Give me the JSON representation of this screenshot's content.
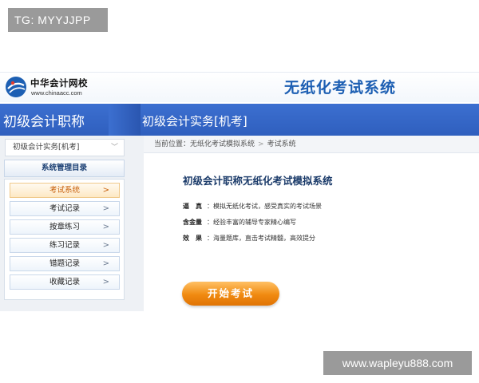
{
  "watermarks": {
    "top_left": "TG: MYYJJPP",
    "bottom_right": "www.wapleyu888.com"
  },
  "header": {
    "logo_name": "中华会计网校",
    "logo_url": "www.chinaacc.com",
    "system_title": "无纸化考试系统"
  },
  "band": {
    "exam_level": "初级会计职称",
    "subject": "初级会计实务[机考]"
  },
  "sidebar": {
    "subject_select": "初级会计实务[机考]",
    "directory_title": "系统管理目录",
    "items": [
      {
        "label": "考试系统",
        "active": true
      },
      {
        "label": "考试记录",
        "active": false
      },
      {
        "label": "按章练习",
        "active": false
      },
      {
        "label": "练习记录",
        "active": false
      },
      {
        "label": "错题记录",
        "active": false
      },
      {
        "label": "收藏记录",
        "active": false
      }
    ]
  },
  "breadcrumb": {
    "prefix": "当前位置：",
    "crumb1": "无纸化考试模拟系统",
    "crumb2": "考试系统"
  },
  "main": {
    "title": "初级会计职称无纸化考试模拟系统",
    "features": [
      {
        "key": "逼　真",
        "text": "：模拟无纸化考试，感受真实的考试场景"
      },
      {
        "key": "含金量",
        "text": "：经验丰富的辅导专家精心编写"
      },
      {
        "key": "效　果",
        "text": "：海量题库，直击考试精髓，高效提分"
      }
    ],
    "start_button": "开始考试"
  },
  "colors": {
    "brand_blue": "#2f5fbe",
    "title_blue": "#1d5fb3",
    "accent_orange": "#f08a10"
  }
}
